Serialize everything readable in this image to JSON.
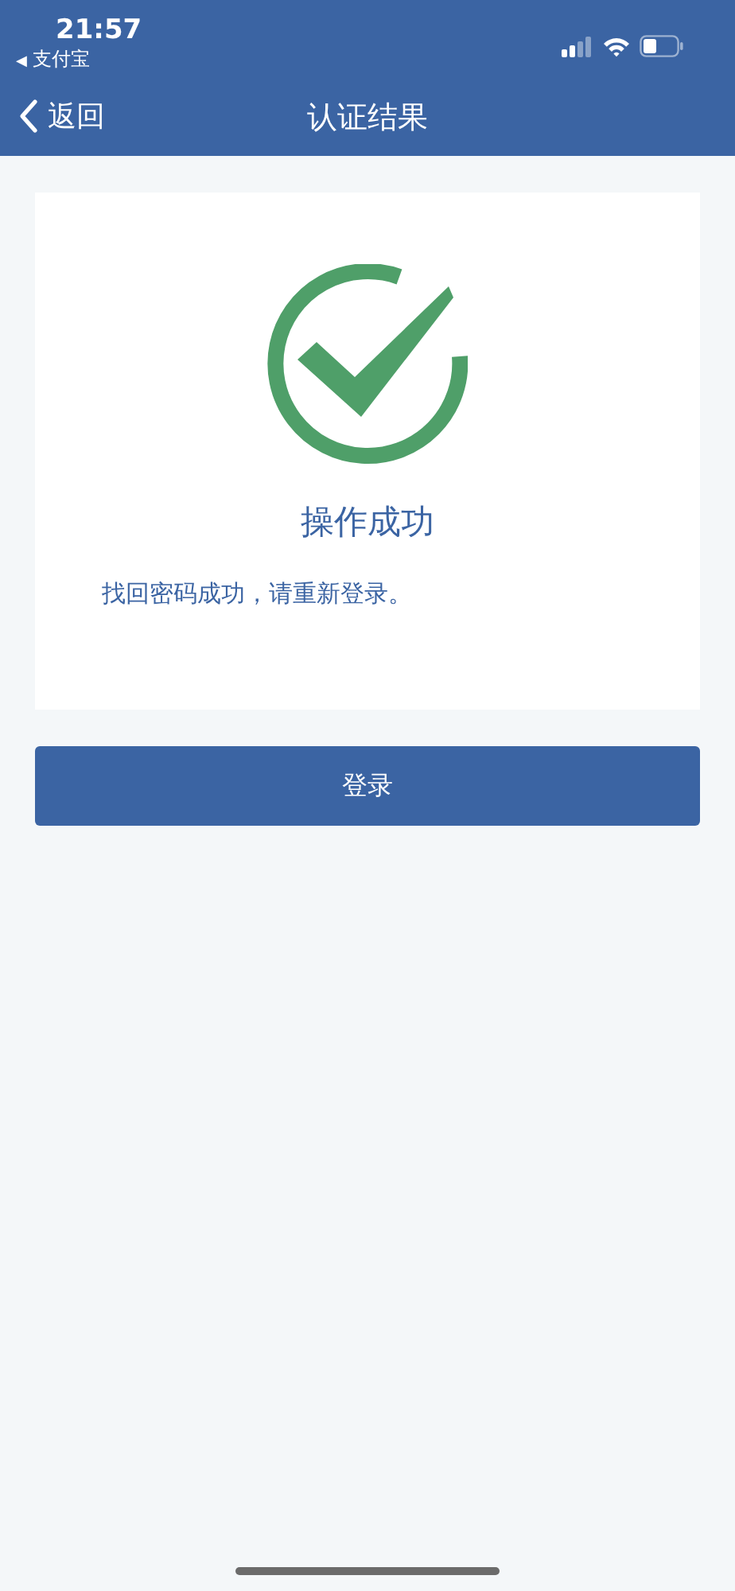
{
  "status_bar": {
    "time": "21:57",
    "back_app": {
      "arrow": "◀",
      "label": "支付宝"
    }
  },
  "nav_bar": {
    "back": "返回",
    "title": "认证结果"
  },
  "result": {
    "success": true,
    "title": "操作成功",
    "message": "找回密码成功，请重新登录。"
  },
  "buttons": [
    {
      "label": "登录"
    }
  ]
}
